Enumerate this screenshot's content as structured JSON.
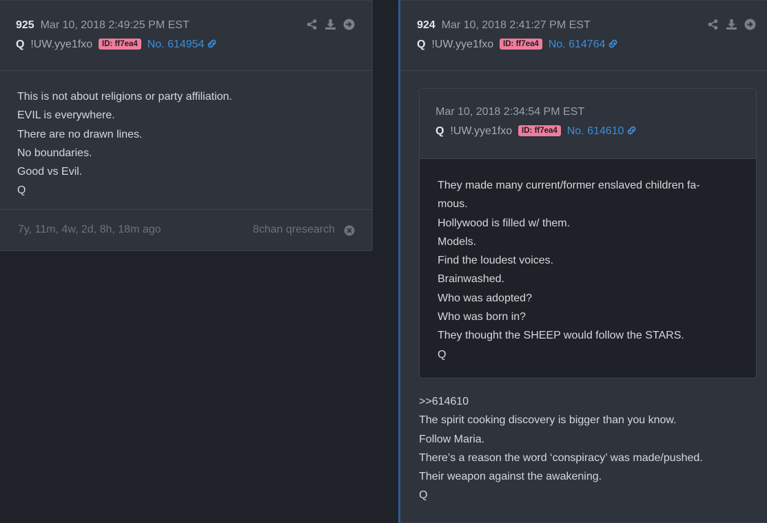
{
  "post_left": {
    "number": "925",
    "date": "Mar 10, 2018 2:49:25 PM EST",
    "author": "Q",
    "tripcode": "!UW.yye1fxo",
    "id_badge": "ID: ff7ea4",
    "post_no": "No. 614954",
    "lines": [
      "This is not about religions or party affiliation.",
      "EVIL is everywhere.",
      "There are no drawn lines.",
      "No boundaries.",
      "Good vs Evil.",
      "Q"
    ],
    "footer_ago": "7y, 11m, 4w, 2d, 8h, 18m ago",
    "footer_source": "8chan qresearch"
  },
  "post_right": {
    "number": "924",
    "date": "Mar 10, 2018 2:41:27 PM EST",
    "author": "Q",
    "tripcode": "!UW.yye1fxo",
    "id_badge": "ID: ff7ea4",
    "post_no": "No. 614764",
    "quoted": {
      "date": "Mar 10, 2018 2:34:54 PM EST",
      "author": "Q",
      "tripcode": "!UW.yye1fxo",
      "id_badge": "ID: ff7ea4",
      "post_no": "No. 614610",
      "lines": [
        "They made many current/former enslaved children fa-",
        "mous.",
        "Hollywood is filled w/ them.",
        "Models.",
        "Find the loudest voices.",
        "Brainwashed.",
        "Who was adopted?",
        "Who was born in?",
        "They thought the SHEEP would follow the STARS.",
        "Q"
      ]
    },
    "lines": [
      ">>614610",
      "The spirit cooking discovery is bigger than you know.",
      "Follow Maria.",
      "There’s a reason the word ‘conspiracy’ was made/pushed.",
      "Their weapon against the awakening.",
      "Q"
    ]
  },
  "icons": [
    "share-icon",
    "download-icon",
    "arrow-right-circle-icon",
    "link-icon",
    "close-circle-icon"
  ],
  "colors": {
    "background": "#1f2229",
    "card": "#2e333c",
    "badge": "#ee7d9c",
    "link": "#3d8fd9",
    "accent_border": "#2d5d94"
  }
}
